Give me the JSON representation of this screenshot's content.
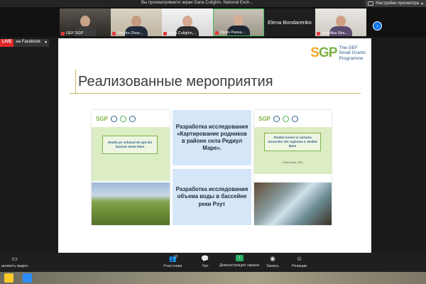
{
  "topbar": {
    "viewing_message": "Вы просматриваете экран Dana Culighin, National Exch...",
    "settings_label": "Настройки просмотра"
  },
  "participants": [
    {
      "name": "GEF SGP",
      "muted": true
    },
    {
      "name": "Dmytro Zhos...",
      "muted": true
    },
    {
      "name": "Lena Culighin,...",
      "muted": true
    },
    {
      "name": "Denis Parea...",
      "muted": true
    },
    {
      "name": "Elena Bondarenko",
      "muted": false,
      "name_only": true
    },
    {
      "name": "Angelika Sha...",
      "muted": true
    }
  ],
  "live": {
    "badge": "LIVE",
    "platform": "на Facebook"
  },
  "slide": {
    "logo_mark": "SGP",
    "logo_text": [
      "The GEF",
      "Small Grants",
      "Programme"
    ],
    "title": "Реализованные мероприятия",
    "left_card": {
      "logo": "SGP",
      "box_text": "Studiu pe volumul de apă din bazinul râului Răut",
      "date": ""
    },
    "right_card": {
      "logo": "SGP",
      "box_text": "Studiul sursei și cartarea izvoarelor din regiunea s. Rediul Mare",
      "date": "Rediul Mare, 2021"
    },
    "blue_top": "Разработка исследования «Картирование родников в районе села Редиул Маре».",
    "blue_bottom": "Разработка исследования объема воды в бассейне реки Рэут"
  },
  "toolbar": {
    "left_label": "ановить видео",
    "participants_label": "Участники",
    "participants_count": "23",
    "chat_label": "Чат",
    "share_label": "Демонстрация экрана",
    "record_label": "Запись",
    "reactions_label": "Реакции"
  },
  "colors": {
    "slide_bg": "#ffffff",
    "title_rule": "#c9b66a",
    "blue_box": "#d4e6f7",
    "sgp_green": "#7cb342",
    "live_red": "#e02828",
    "share_green": "#27ae60",
    "zoom_blue": "#0e72ed"
  }
}
